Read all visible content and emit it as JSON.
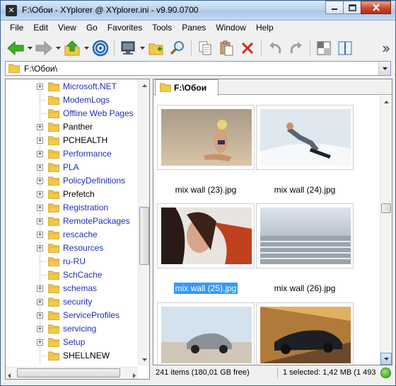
{
  "window": {
    "title": "F:\\Обои - XYplorer @ XYplorer.ini - v9.90.0700",
    "app_icon": "xyplorer-icon"
  },
  "menu": [
    "File",
    "Edit",
    "View",
    "Go",
    "Favorites",
    "Tools",
    "Panes",
    "Window",
    "Help"
  ],
  "address": {
    "value": "F:\\Обои\\"
  },
  "tree": {
    "items": [
      {
        "label": "Microsoft.NET",
        "expandable": true,
        "color": "blue"
      },
      {
        "label": "ModemLogs",
        "expandable": false,
        "color": "blue"
      },
      {
        "label": "Offline Web Pages",
        "expandable": false,
        "color": "blue"
      },
      {
        "label": "Panther",
        "expandable": true,
        "color": "black"
      },
      {
        "label": "PCHEALTH",
        "expandable": true,
        "color": "black"
      },
      {
        "label": "Performance",
        "expandable": true,
        "color": "blue"
      },
      {
        "label": "PLA",
        "expandable": true,
        "color": "blue"
      },
      {
        "label": "PolicyDefinitions",
        "expandable": true,
        "color": "blue"
      },
      {
        "label": "Prefetch",
        "expandable": true,
        "color": "black"
      },
      {
        "label": "Registration",
        "expandable": true,
        "color": "blue"
      },
      {
        "label": "RemotePackages",
        "expandable": true,
        "color": "blue"
      },
      {
        "label": "rescache",
        "expandable": true,
        "color": "blue"
      },
      {
        "label": "Resources",
        "expandable": true,
        "color": "blue"
      },
      {
        "label": "ru-RU",
        "expandable": false,
        "color": "blue"
      },
      {
        "label": "SchCache",
        "expandable": false,
        "color": "blue"
      },
      {
        "label": "schemas",
        "expandable": true,
        "color": "blue"
      },
      {
        "label": "security",
        "expandable": true,
        "color": "blue"
      },
      {
        "label": "ServiceProfiles",
        "expandable": true,
        "color": "blue"
      },
      {
        "label": "servicing",
        "expandable": true,
        "color": "blue"
      },
      {
        "label": "Setup",
        "expandable": true,
        "color": "blue"
      },
      {
        "label": "SHELLNEW",
        "expandable": false,
        "color": "black"
      }
    ]
  },
  "list": {
    "tab_label": "F:\\Обои",
    "files": [
      {
        "name": "mix wall (23).jpg",
        "selected": false
      },
      {
        "name": "mix wall (24).jpg",
        "selected": false
      },
      {
        "name": "mix wall (25).jpg",
        "selected": true
      },
      {
        "name": "mix wall (26).jpg",
        "selected": false
      },
      {
        "name": "",
        "selected": false
      },
      {
        "name": "",
        "selected": false
      }
    ]
  },
  "status": {
    "items": "241 items (180,01 GB free)",
    "selection": "1 selected: 1,42 MB (1 493"
  },
  "colors": {
    "tree_link": "#1e2fb5",
    "selection": "#3399ff"
  }
}
